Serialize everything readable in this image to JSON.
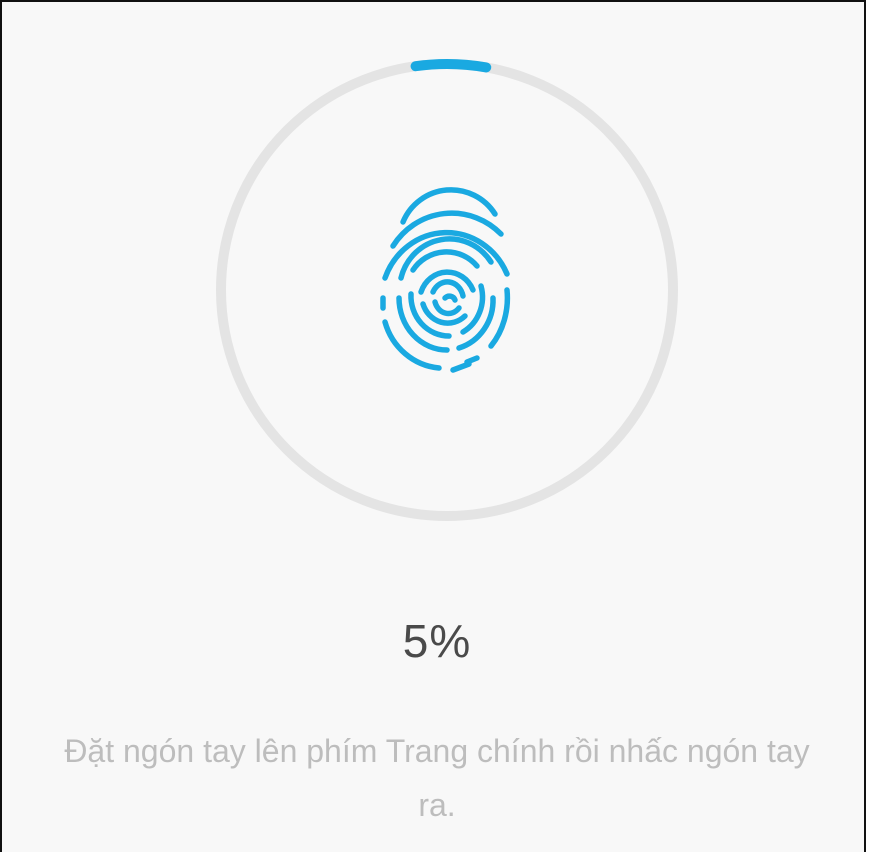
{
  "enrollment": {
    "progress_percent": 5,
    "progress_label": "5%",
    "instruction": "Đặt ngón tay lên phím Trang chính rồi nhấc ngón tay ra."
  },
  "icons": {
    "center": "fingerprint-icon"
  },
  "colors": {
    "accent": "#1aa9e1",
    "ring_track": "#e4e4e4",
    "background": "#f8f8f8",
    "percent_text": "#4a4a4a",
    "instruction_text": "#bdbdbd"
  }
}
